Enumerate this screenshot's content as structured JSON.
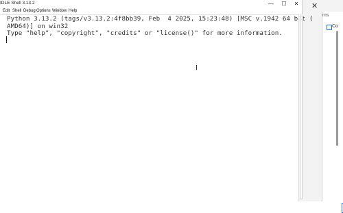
{
  "background_window": {
    "close_glyph": "✕",
    "pane_text": "ms",
    "icon_label": "Co"
  },
  "window": {
    "title": "IDLE Shell 3.13.2",
    "controls": {
      "minimize": "—",
      "maximize": "☐",
      "close": "✕"
    }
  },
  "menu": {
    "items": [
      "Edit",
      "Shell",
      "Debug",
      "Options",
      "Window",
      "Help"
    ]
  },
  "shell": {
    "lines": [
      "Python 3.13.2 (tags/v3.13.2:4f8bb39, Feb  4 2025, 15:23:48) [MSC v.1942 64 bit (",
      "AMD64)] on win32",
      "Type \"help\", \"copyright\", \"credits\" or \"license()\" for more information."
    ]
  },
  "cursor": {
    "glyph": "I"
  }
}
